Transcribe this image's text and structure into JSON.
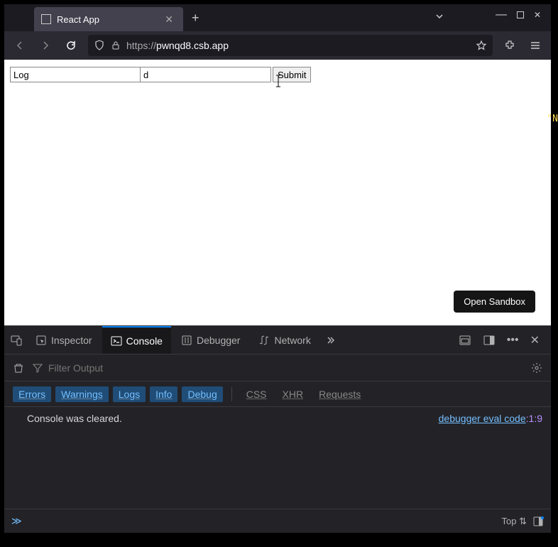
{
  "browser": {
    "tab_title": "React App",
    "url_display_protocol": "https://",
    "url_display_domain": "pwnqd8.csb.app"
  },
  "page": {
    "input1_value": "Log",
    "input2_value": "d",
    "submit_label": "Submit",
    "open_sandbox_label": "Open Sandbox"
  },
  "devtools": {
    "tabs": {
      "inspector": "Inspector",
      "console": "Console",
      "debugger": "Debugger",
      "network": "Network"
    },
    "filter_placeholder": "Filter Output",
    "toggles": {
      "errors": "Errors",
      "warnings": "Warnings",
      "logs": "Logs",
      "info": "Info",
      "debug": "Debug",
      "css": "CSS",
      "xhr": "XHR",
      "requests": "Requests"
    },
    "console_message": "Console was cleared.",
    "console_source": "debugger eval code",
    "console_source_pos": ":1:9",
    "context_label": "Top"
  },
  "edge_text": "\"N"
}
